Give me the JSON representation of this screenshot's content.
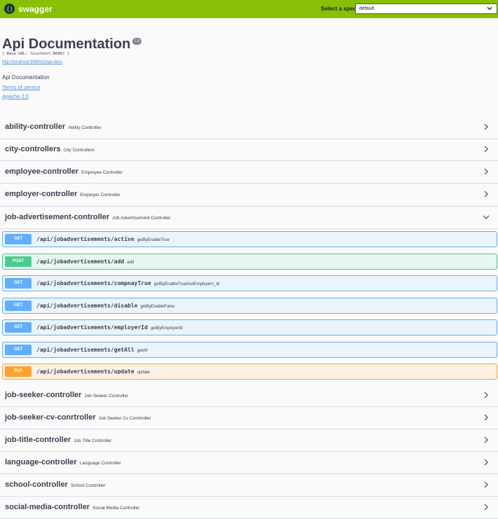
{
  "topbar": {
    "logo_text": "swagger",
    "spec_label": "Select a spec",
    "spec_value": "default"
  },
  "info": {
    "title": "Api Documentation",
    "version": "1.0",
    "base_url": "[ Base URL: localhost:8080/ ]",
    "api_docs_link": "http://localhost:8080/v2/api-docs",
    "description": "Api Documentation",
    "terms": "Terms of service",
    "license": "Apache 2.0"
  },
  "tags": [
    {
      "name": "ability-controller",
      "desc": "Ability Controller",
      "expanded": false
    },
    {
      "name": "city-controllers",
      "desc": "City Controllers",
      "expanded": false
    },
    {
      "name": "employee-controller",
      "desc": "Employee Controller",
      "expanded": false
    },
    {
      "name": "employer-controller",
      "desc": "Employer Controller",
      "expanded": false
    },
    {
      "name": "job-advertisement-controller",
      "desc": "Job Advertisement Controller",
      "expanded": true
    },
    {
      "name": "job-seeker-controller",
      "desc": "Job Seeker Controller",
      "expanded": false
    },
    {
      "name": "job-seeker-cv-conrtroller",
      "desc": "Job Seeker Cv Conrtroller",
      "expanded": false
    },
    {
      "name": "job-title-controller",
      "desc": "Job Title Controller",
      "expanded": false
    },
    {
      "name": "language-controller",
      "desc": "Language Controller",
      "expanded": false
    },
    {
      "name": "school-controller",
      "desc": "School Controller",
      "expanded": false
    },
    {
      "name": "social-media-controller",
      "desc": "Social Media Controller",
      "expanded": false
    }
  ],
  "operations": [
    {
      "method": "GET",
      "path": "/api/jobadvertisements/active",
      "summary": "getByEnableTrue"
    },
    {
      "method": "POST",
      "path": "/api/jobadvertisements/add",
      "summary": "add"
    },
    {
      "method": "GET",
      "path": "/api/jobadvertisements/compnayTrue",
      "summary": "getByEnableTrueAndEmployers_Id"
    },
    {
      "method": "GET",
      "path": "/api/jobadvertisements/disable",
      "summary": "getByEnableFalse"
    },
    {
      "method": "GET",
      "path": "/api/jobadvertisements/employerId",
      "summary": "getByEmployerId"
    },
    {
      "method": "GET",
      "path": "/api/jobadvertisements/getAll",
      "summary": "getAll"
    },
    {
      "method": "PUT",
      "path": "/api/jobadvertisements/update",
      "summary": "update"
    }
  ]
}
